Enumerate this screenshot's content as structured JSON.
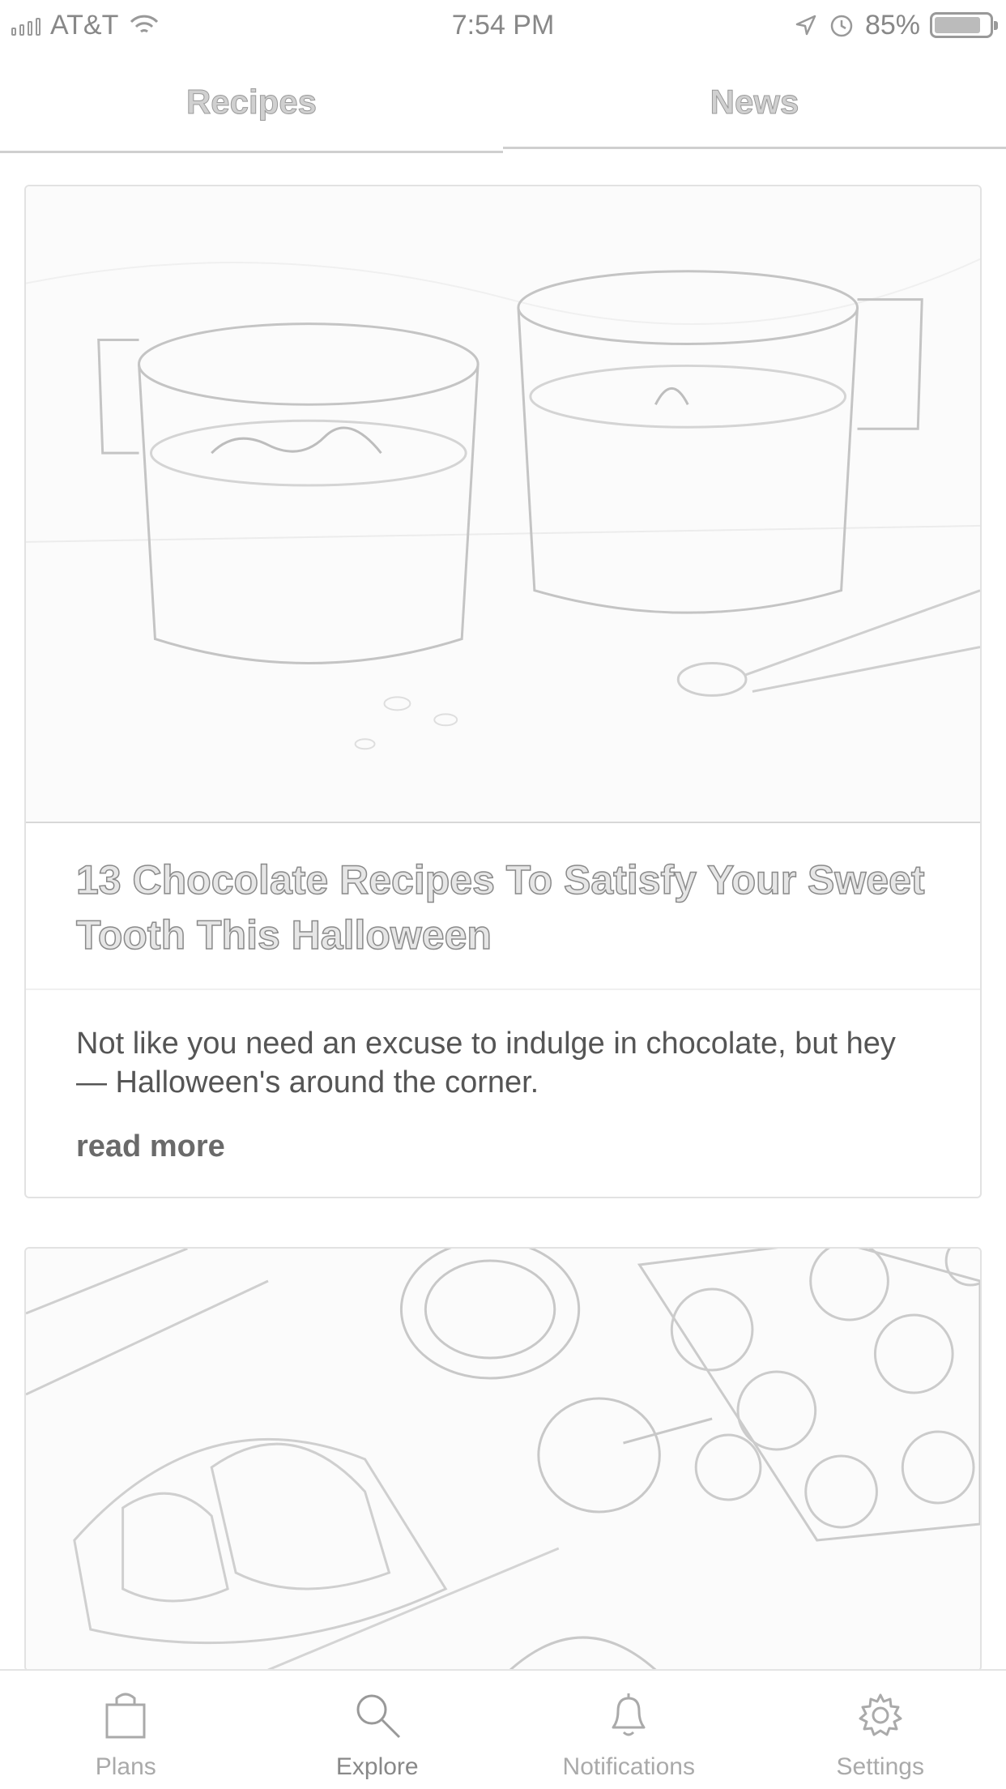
{
  "status_bar": {
    "carrier": "AT&T",
    "time": "7:54 PM",
    "battery": "85%",
    "battery_level": 0.85
  },
  "tabs": [
    {
      "label": "Recipes",
      "selected": true
    },
    {
      "label": "News",
      "selected": false
    }
  ],
  "articles": [
    {
      "title": "13 Chocolate Recipes To Satisfy Your Sweet Tooth This Halloween",
      "description": "Not like you need an excuse to indulge in chocolate, but hey — Halloween's around the corner.",
      "read_more": "read more"
    }
  ],
  "bottom_nav": {
    "items": [
      {
        "label": "Plans",
        "icon": "shopping-bag-icon"
      },
      {
        "label": "Explore",
        "icon": "search-icon",
        "active": true
      },
      {
        "label": "Notifications",
        "icon": "bell-icon"
      },
      {
        "label": "Settings",
        "icon": "gear-icon"
      }
    ]
  }
}
